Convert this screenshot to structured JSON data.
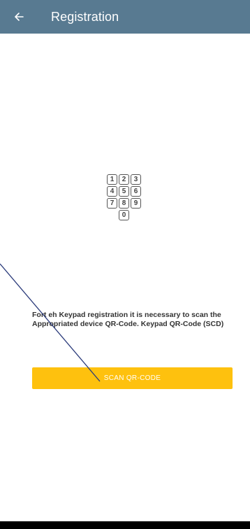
{
  "app_bar": {
    "title": "Registration",
    "back_icon": "arrow-left-icon",
    "background_color": "#587a91"
  },
  "keypad_illustration": {
    "icon": "keypad-icon",
    "keys": [
      "1",
      "2",
      "3",
      "4",
      "5",
      "6",
      "7",
      "8",
      "9",
      "0"
    ]
  },
  "info_text": "Fort eh Keypad registration it is necessary to scan the Appropriated device QR-Code. Keypad QR-Code (SCD)",
  "scan_button": {
    "label": "SCAN QR-CODE",
    "color": "#fec10e"
  },
  "annotation_line_color": "#2a3a7a"
}
